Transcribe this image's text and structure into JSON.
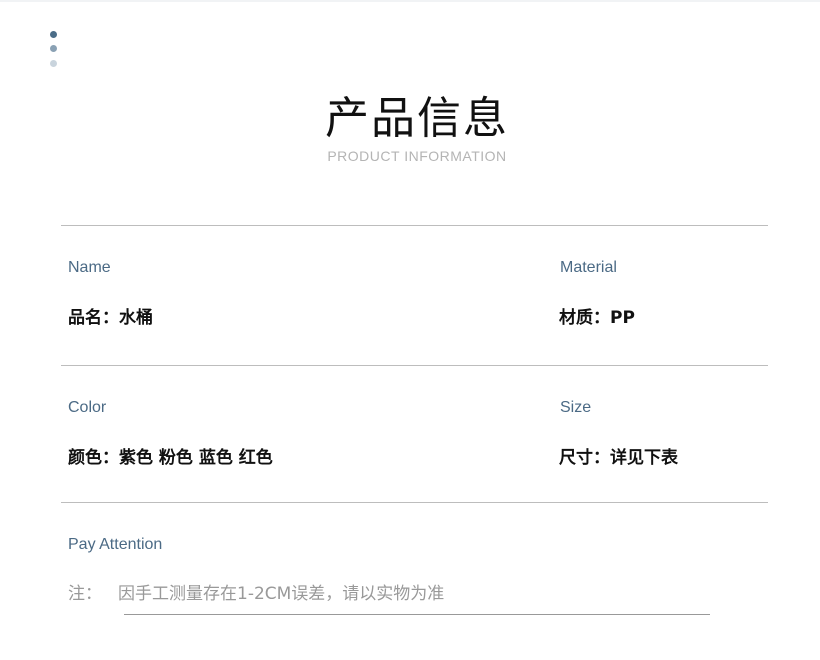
{
  "header": {
    "title": "产品信息",
    "subtitle": "PRODUCT INFORMATION"
  },
  "info": {
    "name": {
      "label": "Name",
      "value": "品名：水桶"
    },
    "material": {
      "label": "Material",
      "value": "材质：PP"
    },
    "color": {
      "label": "Color",
      "value": "颜色：紫色 粉色 蓝色 红色"
    },
    "size": {
      "label": "Size",
      "value": "尺寸：详见下表"
    }
  },
  "attention": {
    "label": "Pay Attention",
    "prefix": "注：",
    "text": "因手工测量存在1-2CM误差，请以实物为准"
  }
}
